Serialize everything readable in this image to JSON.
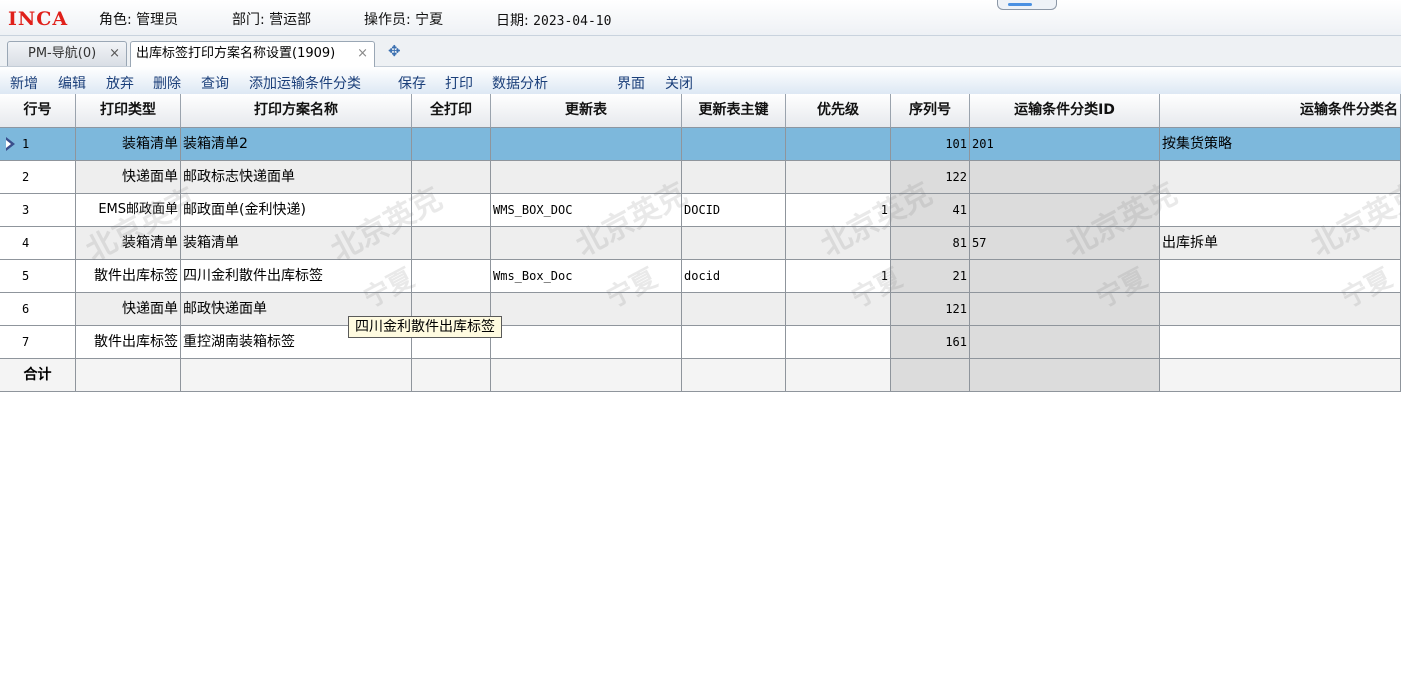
{
  "header": {
    "logo": "INCA",
    "role": "角色: 管理员",
    "dept": "部门: 营运部",
    "operator": "操作员: 宁夏",
    "date_label": "日期: ",
    "date_value": "2023-04-10"
  },
  "tabs": [
    {
      "label": "PM-导航(0)",
      "close": "×"
    },
    {
      "label": "出库标签打印方案名称设置(1909)",
      "close": "×"
    }
  ],
  "add_tab_icon": "✥",
  "toolbar": {
    "add": "新增",
    "edit": "编辑",
    "discard": "放弃",
    "delete": "删除",
    "query": "查询",
    "add_transport": "添加运输条件分类",
    "save": "保存",
    "print": "打印",
    "analysis": "数据分析",
    "interface": "界面",
    "close": "关闭"
  },
  "columns": [
    "行号",
    "打印类型",
    "打印方案名称",
    "全打印",
    "更新表",
    "更新表主键",
    "优先级",
    "序列号",
    "运输条件分类ID",
    "运输条件分类名"
  ],
  "rows": [
    {
      "no": "1",
      "type": "装箱清单",
      "name": "装箱清单2",
      "all": "",
      "table": "",
      "key": "",
      "priority": "",
      "seq": "101",
      "tid": "201",
      "tname": "按集货策略"
    },
    {
      "no": "2",
      "type": "快递面单",
      "name": "邮政标志快递面单",
      "all": "",
      "table": "",
      "key": "",
      "priority": "",
      "seq": "122",
      "tid": "",
      "tname": ""
    },
    {
      "no": "3",
      "type": "EMS邮政面单",
      "name": "邮政面单(金利快递)",
      "all": "",
      "table": "WMS_BOX_DOC",
      "key": "DOCID",
      "priority": "1",
      "seq": "41",
      "tid": "",
      "tname": ""
    },
    {
      "no": "4",
      "type": "装箱清单",
      "name": "装箱清单",
      "all": "",
      "table": "",
      "key": "",
      "priority": "",
      "seq": "81",
      "tid": "57",
      "tname": "出库拆单"
    },
    {
      "no": "5",
      "type": "散件出库标签",
      "name": "四川金利散件出库标签",
      "all": "",
      "table": "Wms_Box_Doc",
      "key": "docid",
      "priority": "1",
      "seq": "21",
      "tid": "",
      "tname": ""
    },
    {
      "no": "6",
      "type": "快递面单",
      "name": "邮政快递面单",
      "all": "",
      "table": "",
      "key": "",
      "priority": "",
      "seq": "121",
      "tid": "",
      "tname": ""
    },
    {
      "no": "7",
      "type": "散件出库标签",
      "name": "重控湖南装箱标签",
      "all": "",
      "table": "",
      "key": "",
      "priority": "",
      "seq": "161",
      "tid": "",
      "tname": ""
    }
  ],
  "total_label": "合计",
  "tooltip": "四川金利散件出库标签",
  "watermark": {
    "company": "北京英克",
    "user": "宁夏"
  },
  "colors": {
    "selected_row": "#7db8dc",
    "logo": "#e0201a",
    "toolbar_text": "#1b3f7a"
  }
}
